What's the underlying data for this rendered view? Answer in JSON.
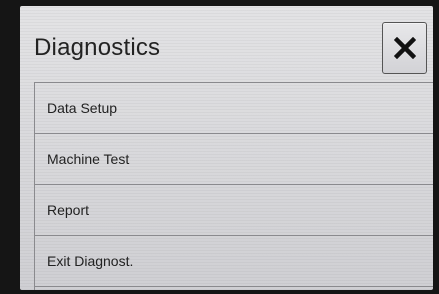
{
  "header": {
    "title": "Diagnostics",
    "close_icon": "close-icon"
  },
  "menu": {
    "items": [
      {
        "label": "Data Setup"
      },
      {
        "label": "Machine Test"
      },
      {
        "label": "Report"
      },
      {
        "label": "Exit Diagnost."
      }
    ]
  }
}
